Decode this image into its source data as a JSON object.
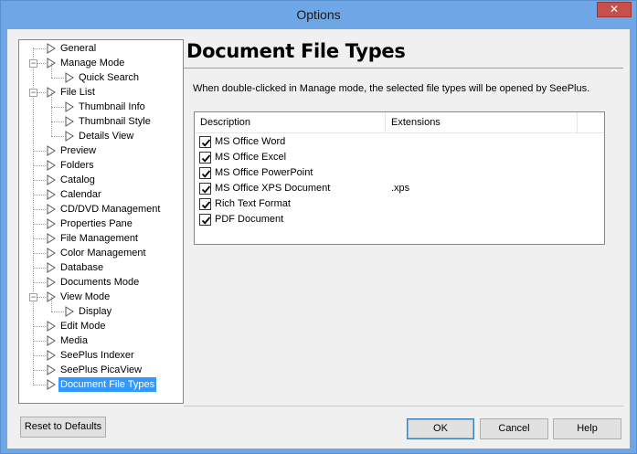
{
  "window": {
    "title": "Options",
    "close_glyph": "✕"
  },
  "tree": {
    "items": [
      {
        "label": "General",
        "level": 0,
        "expander": ""
      },
      {
        "label": "Manage Mode",
        "level": 0,
        "expander": "−"
      },
      {
        "label": "Quick Search",
        "level": 1,
        "expander": ""
      },
      {
        "label": "File List",
        "level": 0,
        "expander": "−"
      },
      {
        "label": "Thumbnail Info",
        "level": 1,
        "expander": ""
      },
      {
        "label": "Thumbnail Style",
        "level": 1,
        "expander": ""
      },
      {
        "label": "Details View",
        "level": 1,
        "expander": ""
      },
      {
        "label": "Preview",
        "level": 0,
        "expander": ""
      },
      {
        "label": "Folders",
        "level": 0,
        "expander": ""
      },
      {
        "label": "Catalog",
        "level": 0,
        "expander": ""
      },
      {
        "label": "Calendar",
        "level": 0,
        "expander": ""
      },
      {
        "label": "CD/DVD Management",
        "level": 0,
        "expander": ""
      },
      {
        "label": "Properties Pane",
        "level": 0,
        "expander": ""
      },
      {
        "label": "File Management",
        "level": 0,
        "expander": ""
      },
      {
        "label": "Color Management",
        "level": 0,
        "expander": ""
      },
      {
        "label": "Database",
        "level": 0,
        "expander": ""
      },
      {
        "label": "Documents Mode",
        "level": 0,
        "expander": ""
      },
      {
        "label": "View Mode",
        "level": 0,
        "expander": "−"
      },
      {
        "label": "Display",
        "level": 1,
        "expander": ""
      },
      {
        "label": "Edit Mode",
        "level": 0,
        "expander": ""
      },
      {
        "label": "Media",
        "level": 0,
        "expander": ""
      },
      {
        "label": "SeePlus Indexer",
        "level": 0,
        "expander": ""
      },
      {
        "label": "SeePlus PicaView",
        "level": 0,
        "expander": ""
      },
      {
        "label": "Document File Types",
        "level": 0,
        "expander": "",
        "selected": true
      }
    ]
  },
  "panel": {
    "title": "Document File Types",
    "description": "When double-clicked in Manage mode, the selected file types will be opened by SeePlus."
  },
  "listview": {
    "columns": [
      "Description",
      "Extensions"
    ],
    "rows": [
      {
        "checked": true,
        "description": "MS Office Word",
        "extensions": ""
      },
      {
        "checked": true,
        "description": "MS Office Excel",
        "extensions": ""
      },
      {
        "checked": true,
        "description": "MS Office PowerPoint",
        "extensions": ""
      },
      {
        "checked": true,
        "description": "MS Office XPS Document",
        "extensions": ".xps"
      },
      {
        "checked": true,
        "description": "Rich Text Format",
        "extensions": ""
      },
      {
        "checked": true,
        "description": "PDF Document",
        "extensions": ""
      }
    ]
  },
  "buttons": {
    "reset": "Reset to Defaults",
    "ok": "OK",
    "cancel": "Cancel",
    "help": "Help"
  },
  "colors": {
    "titlebar": "#6ea6e6",
    "selection": "#3399ff",
    "close_button": "#c7504a"
  }
}
